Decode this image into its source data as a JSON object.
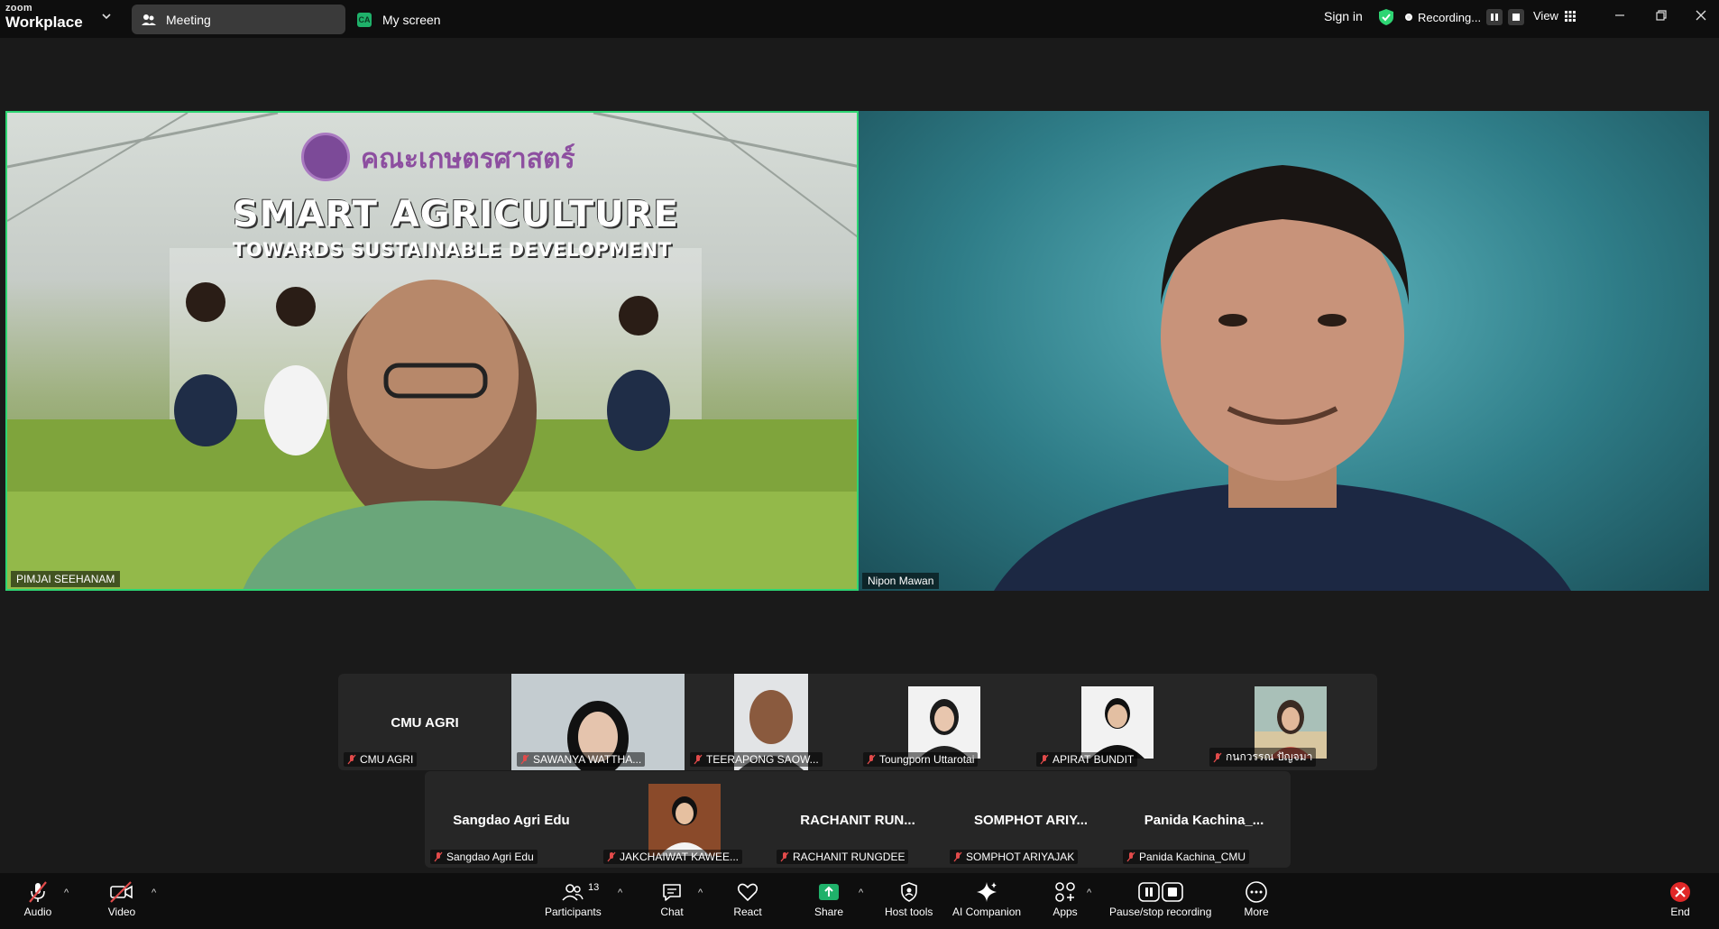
{
  "titlebar": {
    "brand_small": "zoom",
    "brand_large": "Workplace",
    "tab_meeting": "Meeting",
    "tab_screen_badge": "CA",
    "tab_screen": "My screen",
    "sign_in": "Sign in",
    "recording": "Recording...",
    "view": "View"
  },
  "colors": {
    "active_speaker": "#2ed573",
    "toolbar_bg": "#0e0e0e",
    "share_green": "#1fb16a",
    "end_red": "#e02828"
  },
  "main_tiles": [
    {
      "name": "PIMJAI SEEHANAM",
      "slide_logo": "คณะเกษตรศาสตร์",
      "slide_title": "SMART AGRICULTURE",
      "slide_subtitle": "TOWARDS SUSTAINABLE DEVELOPMENT"
    },
    {
      "name": "Nipon Mawan"
    }
  ],
  "participants_row1": [
    {
      "big": "CMU AGRI",
      "name": "CMU AGRI"
    },
    {
      "big": "",
      "name": "SAWANYA WATTHA..."
    },
    {
      "big": "",
      "name": "TEERAPONG SAOW..."
    },
    {
      "big": "",
      "name": "Toungporn Uttarotai"
    },
    {
      "big": "",
      "name": "APIRAT BUNDIT"
    },
    {
      "big": "",
      "name": "กนกวรรณ ปัญจมา"
    }
  ],
  "participants_row2": [
    {
      "big": "Sangdao Agri Edu",
      "name": "Sangdao Agri Edu"
    },
    {
      "big": "",
      "name": "JAKCHAIWAT KAWEE..."
    },
    {
      "big": "RACHANIT RUN...",
      "name": "RACHANIT RUNGDEE"
    },
    {
      "big": "SOMPHOT ARIY...",
      "name": "SOMPHOT ARIYAJAK"
    },
    {
      "big": "Panida Kachina_...",
      "name": "Panida Kachina_CMU"
    }
  ],
  "toolbar": {
    "audio": "Audio",
    "video": "Video",
    "participants": "Participants",
    "participants_count": "13",
    "chat": "Chat",
    "react": "React",
    "share": "Share",
    "host_tools": "Host tools",
    "ai_companion": "AI Companion",
    "apps": "Apps",
    "pause_stop": "Pause/stop recording",
    "more": "More",
    "end": "End"
  }
}
